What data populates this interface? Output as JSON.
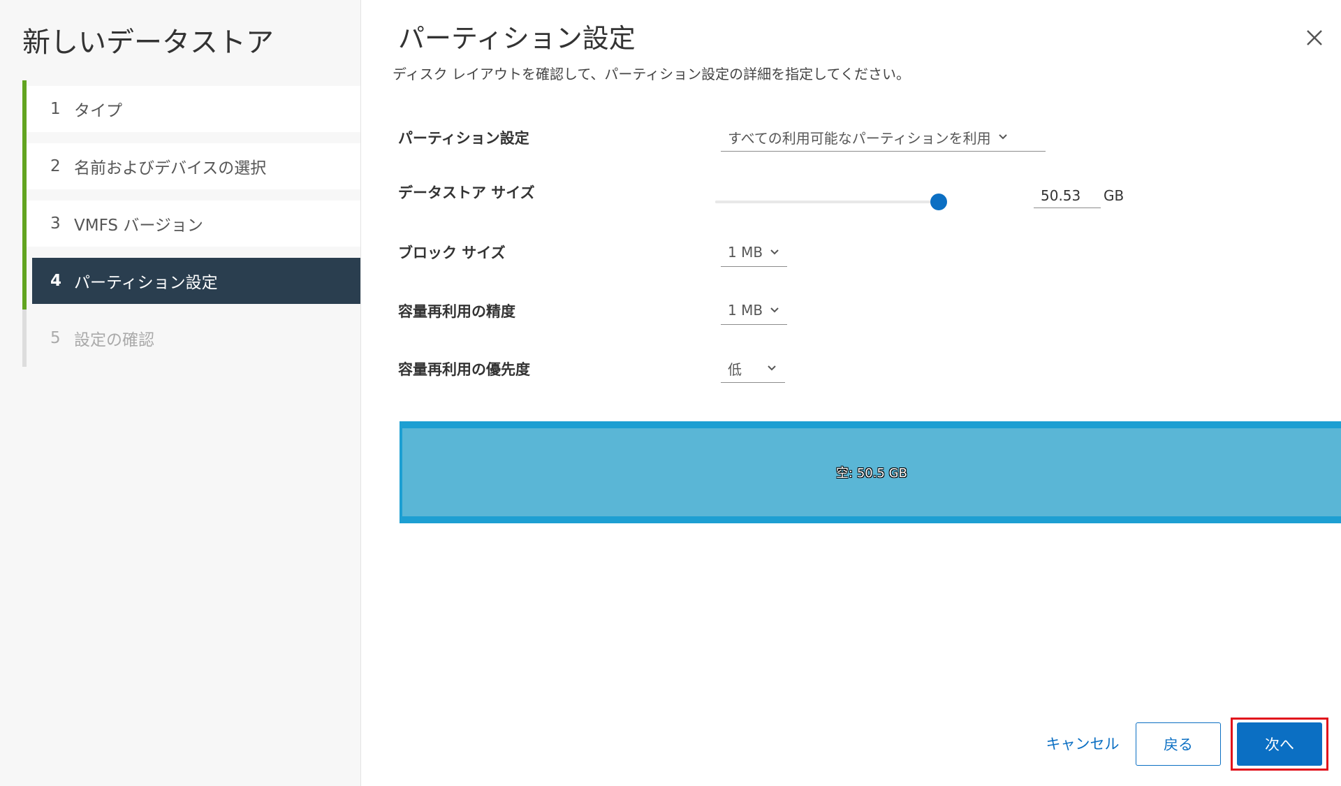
{
  "sidebar": {
    "title": "新しいデータストア",
    "steps": [
      {
        "num": "1",
        "label": "タイプ",
        "state": "completed"
      },
      {
        "num": "2",
        "label": "名前およびデバイスの選択",
        "state": "completed"
      },
      {
        "num": "3",
        "label": "VMFS バージョン",
        "state": "completed"
      },
      {
        "num": "4",
        "label": "パーティション設定",
        "state": "active"
      },
      {
        "num": "5",
        "label": "設定の確認",
        "state": "pending"
      }
    ]
  },
  "main": {
    "title": "パーティション設定",
    "subtitle": "ディスク レイアウトを確認して、パーティション設定の詳細を指定してください。",
    "fields": {
      "partition_config": {
        "label": "パーティション設定",
        "value": "すべての利用可能なパーティションを利用"
      },
      "datastore_size": {
        "label": "データストア サイズ",
        "value": "50.53",
        "unit": "GB",
        "slider_percent": 100
      },
      "block_size": {
        "label": "ブロック サイズ",
        "value": "1 MB"
      },
      "reclamation_granularity": {
        "label": "容量再利用の精度",
        "value": "1 MB"
      },
      "reclamation_priority": {
        "label": "容量再利用の優先度",
        "value": "低"
      }
    },
    "disk_layout": {
      "partitions": [
        {
          "label": "空: 50.5 GB",
          "size_gb": 50.5
        }
      ]
    }
  },
  "footer": {
    "cancel_label": "キャンセル",
    "back_label": "戻る",
    "next_label": "次へ"
  },
  "colors": {
    "accent": "#0b6fc3",
    "completed_step": "#62a420",
    "active_step_bg": "#2a3e4f",
    "disk_outer": "#1d9fd2",
    "disk_free": "#5ab6d6",
    "highlight": "#e1111b"
  }
}
